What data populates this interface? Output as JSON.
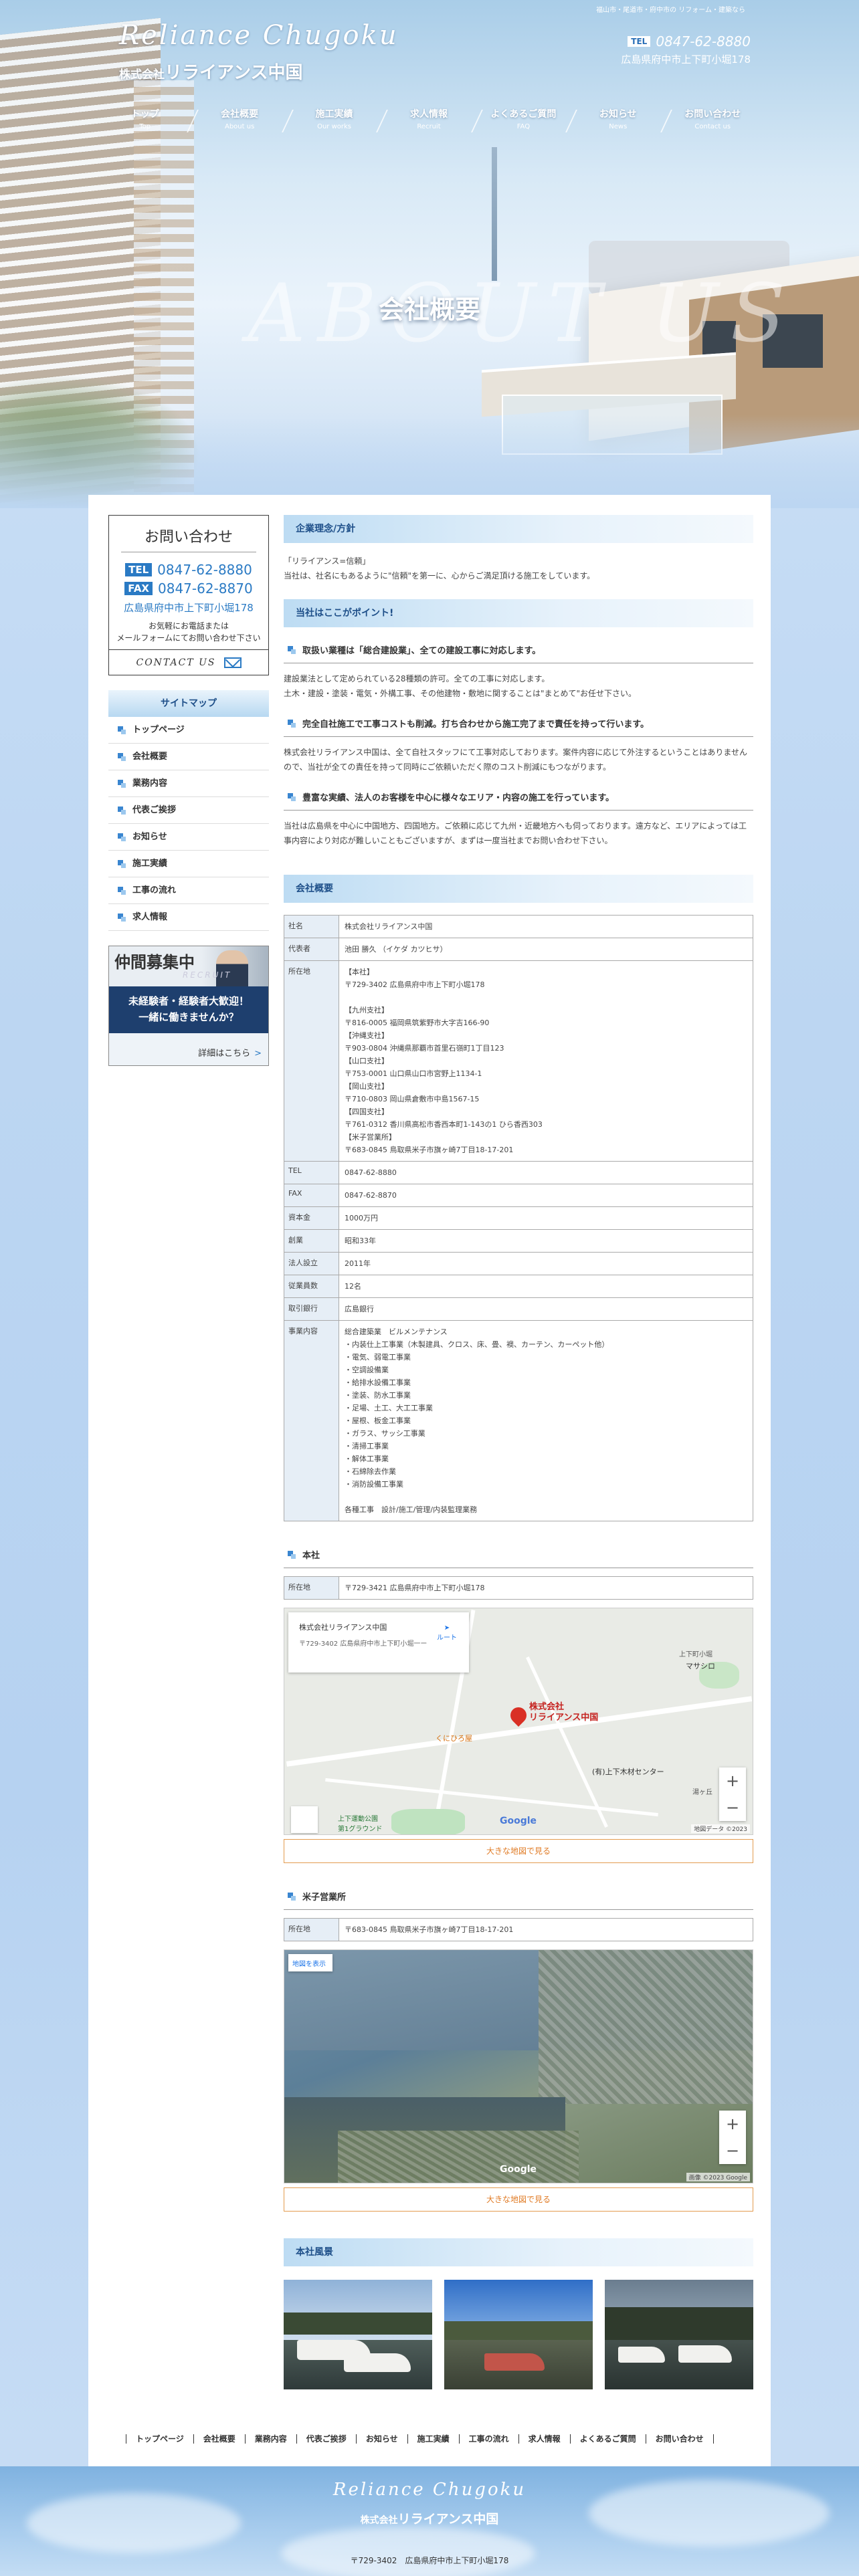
{
  "header": {
    "catch": "福山市・尾道市・府中市の リフォーム・建築なら",
    "logo_en": "Reliance Chugoku",
    "logo_jp_prefix": "株式会社",
    "logo_jp_name": "リライアンス中国",
    "tel_tag": "TEL",
    "tel": "0847-62-8880",
    "address": "広島県府中市上下町小堀178"
  },
  "nav": [
    {
      "jp": "トップ",
      "en": "Top"
    },
    {
      "jp": "会社概要",
      "en": "About us"
    },
    {
      "jp": "施工実績",
      "en": "Our works"
    },
    {
      "jp": "求人情報",
      "en": "Recruit"
    },
    {
      "jp": "よくあるご質問",
      "en": "FAQ"
    },
    {
      "jp": "お知らせ",
      "en": "News"
    },
    {
      "jp": "お問い合わせ",
      "en": "Contact us"
    }
  ],
  "page": {
    "bg_title": "ABOUT US",
    "title": "会社概要"
  },
  "sidebar": {
    "contact_title": "お問い合わせ",
    "tel_label": "TEL",
    "tel": "0847-62-8880",
    "fax_label": "FAX",
    "fax": "0847-62-8870",
    "address": "広島県府中市上下町小堀178",
    "note_line1": "お気軽にお電話または",
    "note_line2": "メールフォームにてお問い合わせ下さい",
    "contact_btn": "CONTACT US",
    "sitemap_title": "サイトマップ",
    "sitemap": [
      "トップページ",
      "会社概要",
      "業務内容",
      "代表ご挨拶",
      "お知らせ",
      "施工実績",
      "工事の流れ",
      "求人情報"
    ],
    "recruit_title": "仲間募集中",
    "recruit_en": "RECRUIT",
    "recruit_line1": "未経験者・経験者大歓迎！",
    "recruit_line2": "一緒に働きませんか？",
    "recruit_link": "詳細はこちら"
  },
  "philosophy": {
    "heading": "企業理念/方針",
    "quote": "「リライアンス=信頼」",
    "text": "当社は、社名にもあるように\"信頼\"を第一に、心からご満足頂ける施工をしています。"
  },
  "points": {
    "heading": "当社はここがポイント!",
    "items": [
      {
        "title": "取扱い業種は「総合建設業」、全ての建設工事に対応します。",
        "text1": "建設業法として定められている28種類の許可。全ての工事に対応します。",
        "text2": "土木・建設・塗装・電気・外構工事、その他建物・敷地に関することは\"まとめて\"お任せ下さい。"
      },
      {
        "title": "完全自社施工で工事コストも削減。打ち合わせから施工完了まで責任を持って行います。",
        "text1": "株式会社リライアンス中国は、全て自社スタッフにて工事対応しております。案件内容に応じて外注するということはありませんので、当社が全ての責任を持って同時にご依頼いただく際のコスト削減にもつながります。",
        "text2": ""
      },
      {
        "title": "豊富な実績、法人のお客様を中心に様々なエリア・内容の施工を行っています。",
        "text1": "当社は広島県を中心に中国地方、四国地方。ご依頼に応じて九州・近畿地方へも伺っております。遠方など、エリアによっては工事内容により対応が難しいこともございますが、まずは一度当社までお問い合わせ下さい。",
        "text2": ""
      }
    ]
  },
  "overview": {
    "heading": "会社概要",
    "rows": [
      {
        "label": "社名",
        "value": "株式会社リライアンス中国"
      },
      {
        "label": "代表者",
        "value": "池田 勝久 （イケダ カツヒサ）"
      },
      {
        "label": "所在地",
        "lines": [
          "【本社】",
          "〒729-3402 広島県府中市上下町小堀178",
          "",
          "【九州支社】",
          "〒816-0005 福岡県筑紫野市大字吉166-90",
          "【沖縄支社】",
          "〒903-0804 沖縄県那覇市首里石嶺町1丁目123",
          "【山口支社】",
          "〒753-0001 山口県山口市宮野上1134-1",
          "【岡山支社】",
          "〒710-0803 岡山県倉敷市中島1567-15",
          "【四国支社】",
          "〒761-0312 香川県高松市香西本町1-143の1 ひら香西303",
          "【米子営業所】",
          "〒683-0845 鳥取県米子市旗ヶ崎7丁目18-17-201"
        ]
      },
      {
        "label": "TEL",
        "value": "0847-62-8880"
      },
      {
        "label": "FAX",
        "value": "0847-62-8870"
      },
      {
        "label": "資本金",
        "value": "1000万円"
      },
      {
        "label": "創業",
        "value": "昭和33年"
      },
      {
        "label": "法人設立",
        "value": "2011年"
      },
      {
        "label": "従業員数",
        "value": "12名"
      },
      {
        "label": "取引銀行",
        "value": "広島銀行"
      },
      {
        "label": "事業内容",
        "lines": [
          "総合建築業　ビルメンテナンス",
          "・内装仕上工事業（木製建具、クロス、床、畳、襖、カーテン、カーペット他）",
          "・電気、弱電工事業",
          "・空調設備業",
          "・給排水設備工事業",
          "・塗装、防水工事業",
          "・足場、土工、大工工事業",
          "・屋根、板金工事業",
          "・ガラス、サッシ工事業",
          "・清掃工事業",
          "・解体工事業",
          "・石綿除去作業",
          "・消防設備工事業",
          "",
          "各種工事　設計/施工/管理/内装監理業務"
        ]
      }
    ]
  },
  "honsha": {
    "heading": "本社",
    "label": "所在地",
    "value": "〒729-3421 広島県府中市上下町小堀178",
    "map_card_title": "株式会社リライアンス中国",
    "map_card_addr": "〒729-3402 広島県府中市上下町小堀一ー",
    "map_dir": "ルート",
    "pin_line1": "株式会社",
    "pin_line2": "リライアンス中国",
    "place1": "くにひろ屋",
    "place2": "(有)上下木材センター",
    "place3": "マサシロ",
    "place4": "上下町小堀",
    "place5": "上下運動公園\n第1グラウンド",
    "place6": "湯ヶ丘",
    "google": "Google",
    "attribution": "地図データ ©2023",
    "map_btn": "大きな地図で見る"
  },
  "yonago": {
    "heading": "米子営業所",
    "label": "所在地",
    "value": "〒683-0845 鳥取県米子市旗ヶ崎7丁目18-17-201",
    "map_card": "地図を表示",
    "google": "Google",
    "attribution": "画像 ©2023 Google",
    "map_btn": "大きな地図で見る"
  },
  "scenery": {
    "heading": "本社風景"
  },
  "footer": {
    "nav": [
      "トップページ",
      "会社概要",
      "業務内容",
      "代表ご挨拶",
      "お知らせ",
      "施工実績",
      "工事の流れ",
      "求人情報",
      "よくあるご質問",
      "お問い合わせ"
    ],
    "logo_en": "Reliance Chugoku",
    "logo_jp_prefix": "株式会社",
    "logo_jp_name": "リライアンス中国",
    "address": "〒729-3402　広島県府中市上下町小堀178"
  }
}
